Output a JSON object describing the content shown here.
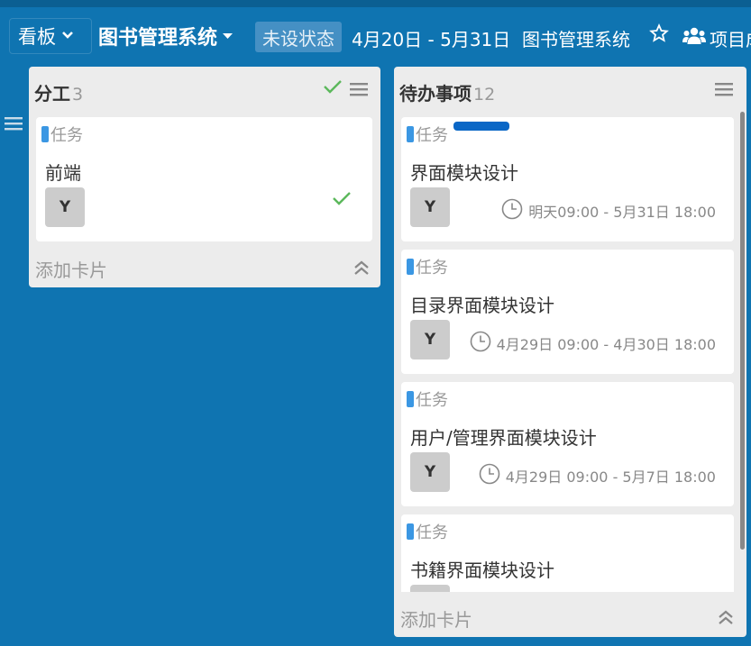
{
  "header": {
    "view_label": "看板",
    "board_title": "图书管理系统",
    "status": "未设状态",
    "date_range": "4月20日 - 5月31日",
    "project_name": "图书管理系统",
    "members_label": "项目成员"
  },
  "lists": [
    {
      "title": "分工",
      "count": "3",
      "add_label": "添加卡片",
      "cards": [
        {
          "tag": "任务",
          "title": "前端",
          "avatar": "Y"
        }
      ]
    },
    {
      "title": "待办事项",
      "count": "12",
      "add_label": "添加卡片",
      "cards": [
        {
          "tag": "任务",
          "title": "界面模块设计",
          "avatar": "Y",
          "date": "明天09:00 - 5月31日 18:00",
          "label_color": "#0a67c6"
        },
        {
          "tag": "任务",
          "title": "目录界面模块设计",
          "avatar": "Y",
          "date": "4月29日 09:00 - 4月30日 18:00"
        },
        {
          "tag": "任务",
          "title": "用户/管理界面模块设计",
          "avatar": "Y",
          "date": "4月29日 09:00 - 5月7日 18:00"
        },
        {
          "tag": "任务",
          "title": "书籍界面模块设计",
          "avatar": "Y"
        }
      ]
    }
  ],
  "colors": {
    "background": "#0f74b1",
    "tag": "#3b97e3",
    "check": "#5cb85c"
  },
  "icons": [
    "chevron-down-icon",
    "caret-down-icon",
    "star-icon",
    "users-icon",
    "menu-icon",
    "check-icon",
    "clock-icon",
    "double-chevron-up-icon"
  ]
}
